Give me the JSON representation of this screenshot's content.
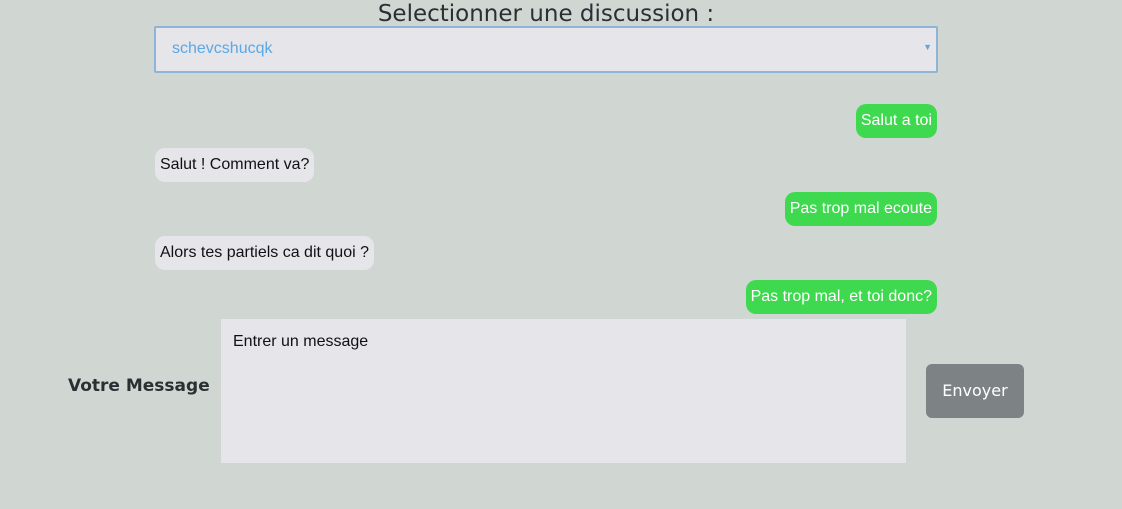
{
  "header": {
    "title": "Selectionner une discussion :"
  },
  "discussion_select": {
    "selected": "schevcshucqk",
    "icon": "chevron-down-icon"
  },
  "messages": [
    {
      "direction": "sent",
      "text": "Salut a toi"
    },
    {
      "direction": "received",
      "text": "Salut ! Comment va?"
    },
    {
      "direction": "sent",
      "text": "Pas trop mal ecoute"
    },
    {
      "direction": "received",
      "text": "Alors tes partiels ca dit quoi ?"
    },
    {
      "direction": "sent",
      "text": "Pas trop mal, et toi donc?"
    }
  ],
  "composer": {
    "label": "Votre Message",
    "placeholder": "Entrer un message",
    "send_label": "Envoyer"
  },
  "colors": {
    "background": "#d0d7d3",
    "sent_bubble": "#3fd94f",
    "received_bubble": "#e6e6ea",
    "select_text": "#5aa8e6",
    "send_button": "#7d8384"
  }
}
